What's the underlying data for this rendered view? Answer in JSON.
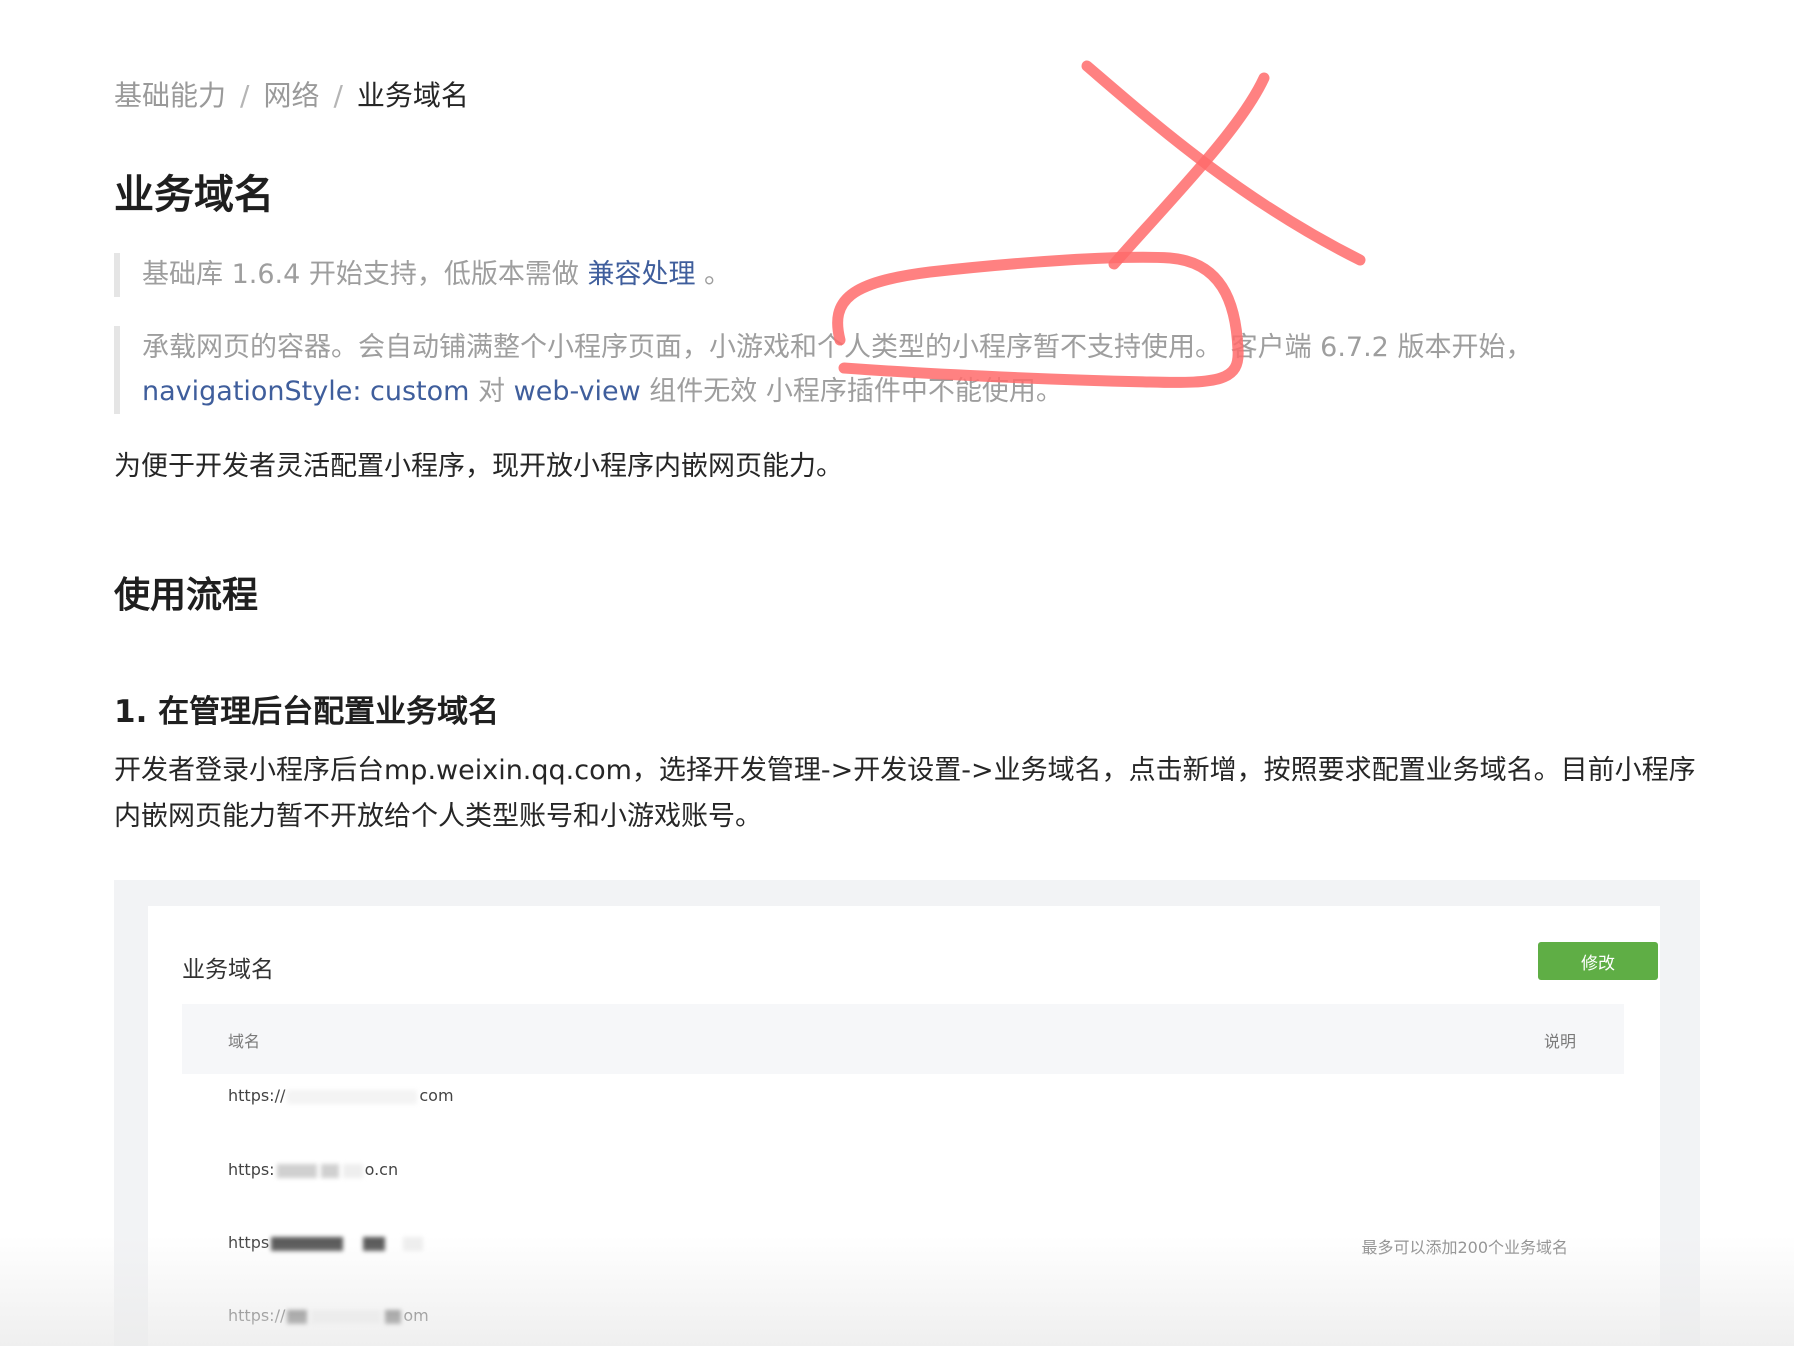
{
  "breadcrumb": {
    "items": [
      "基础能力",
      "网络"
    ],
    "current": "业务域名",
    "separator": "/"
  },
  "page_title": "业务域名",
  "notice1": {
    "prefix": "基础库 1.6.4 开始支持，低版本需做 ",
    "link": "兼容处理",
    "suffix": " 。"
  },
  "notice2": {
    "text1": "承载网页的容器。会自动铺满整个小程序页面，小游戏和个人类型的小程序暂不支持使用。 客户端 6.7.2 版本开始，",
    "code1": "navigationStyle: custom",
    "text2": " 对 ",
    "code2": "web-view",
    "text3": " 组件无效 小程序插件中不能使用。"
  },
  "intro": "为便于开发者灵活配置小程序，现开放小程序内嵌网页能力。",
  "section_title": "使用流程",
  "step1": {
    "title": "1. 在管理后台配置业务域名",
    "text": "开发者登录小程序后台mp.weixin.qq.com，选择开发管理->开发设置->业务域名，点击新增，按照要求配置业务域名。目前小程序内嵌网页能力暂不开放给个人类型账号和小游戏账号。"
  },
  "screenshot": {
    "card_title": "业务域名",
    "edit_button": "修改",
    "col_domain": "域名",
    "col_desc": "说明",
    "rows": [
      {
        "start": "https://",
        "end": "com"
      },
      {
        "start": "https:",
        "end": "o.cn"
      },
      {
        "start": "https",
        "end": ""
      },
      {
        "start": "https://",
        "end": "om"
      }
    ],
    "note": "最多可以添加200个业务域名"
  },
  "colors": {
    "link": "#3f5e9c",
    "annotation": "#ff6b6b",
    "button": "#5fae45"
  }
}
